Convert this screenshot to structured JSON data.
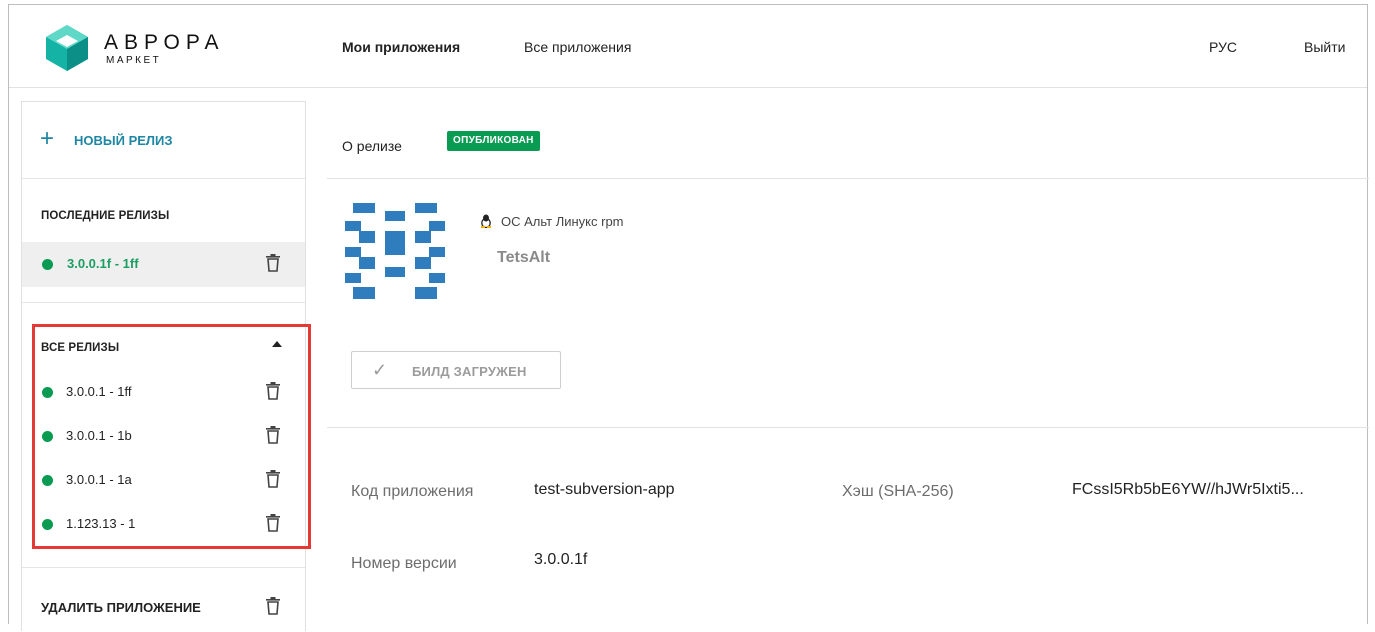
{
  "header": {
    "brand": "АВРОРА",
    "brand_sub": "МАРКЕТ",
    "nav": {
      "my_apps": "Мои приложения",
      "all_apps": "Все приложения"
    },
    "language": "РУС",
    "logout": "Выйти"
  },
  "sidebar": {
    "new_release": "НОВЫЙ РЕЛИЗ",
    "recent_title": "ПОСЛЕДНИЕ РЕЛИЗЫ",
    "recent": [
      {
        "label": "3.0.0.1f - 1ff"
      }
    ],
    "all_title": "ВСЕ РЕЛИЗЫ",
    "all": [
      {
        "label": "3.0.0.1 - 1ff"
      },
      {
        "label": "3.0.0.1 - 1b"
      },
      {
        "label": "3.0.0.1 - 1a"
      },
      {
        "label": "1.123.13 - 1"
      }
    ],
    "delete_app": "УДАЛИТЬ ПРИЛОЖЕНИЕ"
  },
  "main": {
    "about": "О релизе",
    "status": "ОПУБЛИКОВАН",
    "os": "ОС Альт Линукс rpm",
    "app_name": "TetsAlt",
    "build_button": "БИЛД ЗАГРУЖЕН",
    "fields": {
      "code_label": "Код приложения",
      "code_value": "test-subversion-app",
      "hash_label": "Хэш (SHA-256)",
      "hash_value": "FCssI5Rb5bE6YW//hJWr5Ixti5...",
      "version_label": "Номер версии",
      "version_value": "3.0.0.1f"
    }
  },
  "colors": {
    "accent": "#1f86a3",
    "status_green": "#0a9b52",
    "highlight": "#e53935",
    "app_icon": "#2f7dbd"
  },
  "icons": [
    "aurora-logo",
    "plus-icon",
    "trash-icon",
    "caret-up-icon",
    "linux-icon",
    "check-icon",
    "app-icon"
  ]
}
